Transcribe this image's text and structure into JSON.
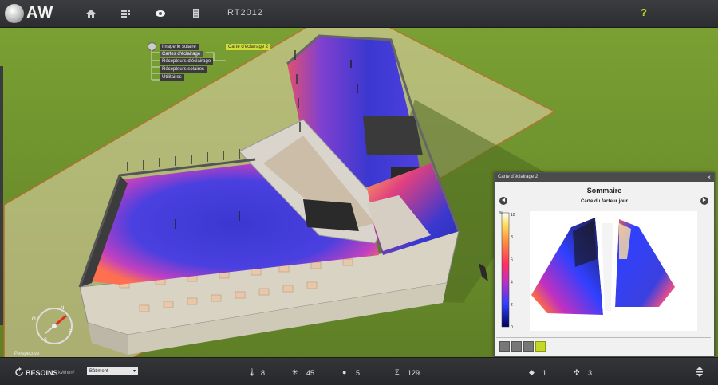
{
  "app": {
    "logo_text": "AW",
    "project_title": "RT2012"
  },
  "top_icons": [
    "home-icon",
    "grid-icon",
    "eye-icon",
    "document-icon"
  ],
  "help_label": "?",
  "tree": {
    "root_icon": "settings-icon",
    "items": [
      {
        "label": "Imagerie solaire"
      },
      {
        "label": "Cartes d'éclairage"
      },
      {
        "label": "Récepteurs d'éclairage"
      },
      {
        "label": "Récepteurs solaires"
      },
      {
        "label": "Utilitaires"
      }
    ],
    "child": {
      "label": "Carte d'éclairage 2"
    }
  },
  "compass": {
    "n": "N",
    "e": "E",
    "s": "S",
    "w": "O"
  },
  "view_mode": "Perspective",
  "panel": {
    "title": "Carte d'éclairage 2",
    "close": "×",
    "heading": "Sommaire",
    "subheading": "Carte du facteur jour",
    "prev": "◄",
    "next": "►"
  },
  "chart_data": {
    "type": "heatmap",
    "title": "Carte du facteur jour",
    "colorbar_unit": "%",
    "colorbar_ticks": [
      "0",
      "2",
      "4",
      "6",
      "8",
      "10"
    ],
    "colorbar_range": [
      0,
      10
    ],
    "colormap": [
      "#000060",
      "#3040ff",
      "#c030c0",
      "#ff3060",
      "#ff9040",
      "#ffe060",
      "#ffffff"
    ]
  },
  "bottom": {
    "besoins_label": "BESOINS",
    "besoins_unit": "kWh/m²",
    "select_value": "Bâtiment",
    "stats": [
      {
        "icon": "thermometer-icon",
        "value": "8"
      },
      {
        "icon": "snowflake-icon",
        "value": "45"
      },
      {
        "icon": "bulb-icon",
        "value": "5"
      },
      {
        "icon": "sigma-icon",
        "value": "129"
      },
      {
        "icon": "drop-icon",
        "value": "1"
      },
      {
        "icon": "fan-icon",
        "value": "3"
      }
    ]
  },
  "colors": {
    "accent": "#c6d826",
    "ground": "#6f8f2e",
    "bar": "#2f3134"
  }
}
